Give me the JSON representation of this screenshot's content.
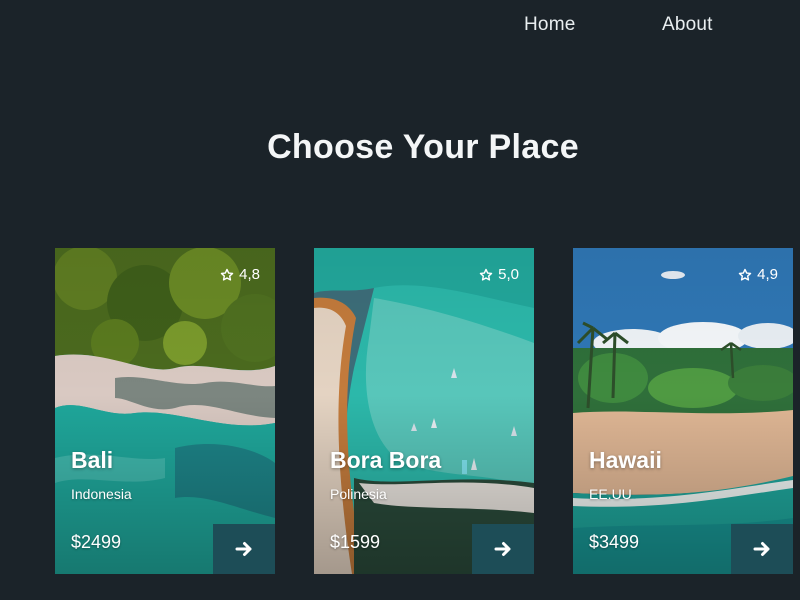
{
  "nav": {
    "home_label": "Home",
    "about_label": "About"
  },
  "title": "Choose Your Place",
  "cards": [
    {
      "name": "Bali",
      "region": "Indonesia",
      "price": "$2499",
      "rating": "4,8"
    },
    {
      "name": "Bora Bora",
      "region": "Polinesia",
      "price": "$1599",
      "rating": "5,0"
    },
    {
      "name": "Hawaii",
      "region": "EE.UU",
      "price": "$3499",
      "rating": "4,9"
    }
  ],
  "icons": {
    "rating": "star-outline-icon",
    "go": "arrow-right-icon"
  },
  "colors": {
    "background": "#1b2329",
    "button": "#1d4d57",
    "text": "#ffffff"
  }
}
